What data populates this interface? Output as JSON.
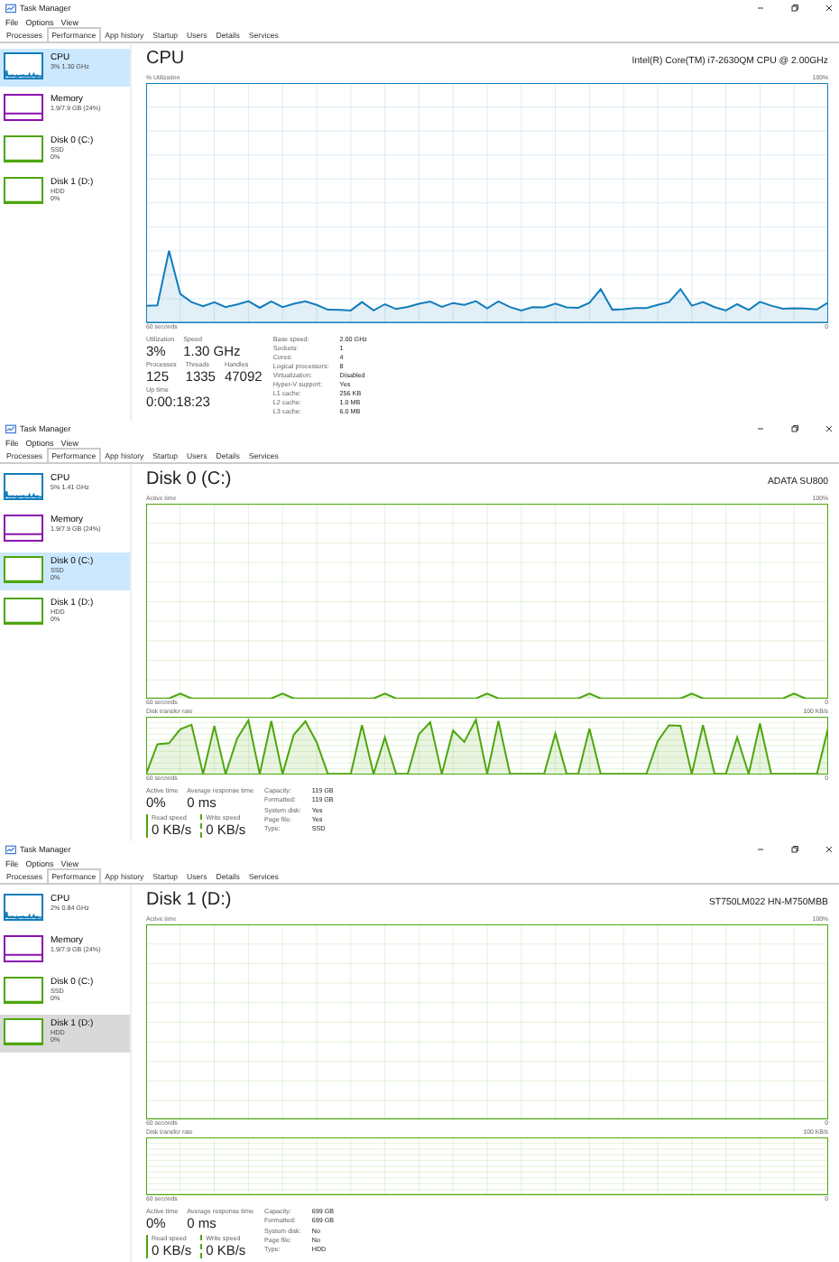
{
  "windows": [
    {
      "title": "Task Manager",
      "focused": true,
      "menu": [
        "File",
        "Options",
        "View"
      ],
      "tabs": [
        {
          "label": "Processes",
          "selected": false
        },
        {
          "label": "Performance",
          "selected": true
        },
        {
          "label": "App history",
          "selected": false
        },
        {
          "label": "Startup",
          "selected": false
        },
        {
          "label": "Users",
          "selected": false
        },
        {
          "label": "Details",
          "selected": false
        },
        {
          "label": "Services",
          "selected": false
        }
      ],
      "sidebar": [
        {
          "name": "CPU",
          "details": [
            "3% 1.30 GHz"
          ],
          "color": "#117dbb",
          "selected": true
        },
        {
          "name": "Memory",
          "details": [
            "1.9/7.9 GB (24%)"
          ],
          "color": "#8b12ae",
          "selected": false
        },
        {
          "name": "Disk 0 (C:)",
          "details": [
            "SSD",
            "0%"
          ],
          "color": "#4da60c",
          "selected": false
        },
        {
          "name": "Disk 1 (D:)",
          "details": [
            "HDD",
            "0%"
          ],
          "color": "#4da60c",
          "selected": false
        }
      ],
      "panel": {
        "title": "CPU",
        "model": "Intel(R) Core(TM) i7-2630QM CPU @ 2.00GHz",
        "graphs": [
          {
            "label": "% Utilization",
            "max": "100%",
            "span": "60 seconds",
            "min": "0"
          }
        ],
        "stat_rows": [
          [
            {
              "label": "Utilization",
              "value": "3%"
            },
            {
              "label": "Speed",
              "value": "1.30 GHz"
            }
          ],
          [
            {
              "label": "Processes",
              "value": "125"
            },
            {
              "label": "Threads",
              "value": "1335"
            },
            {
              "label": "Handles",
              "value": "47092"
            }
          ],
          [
            {
              "label": "Up time",
              "value": "0:00:18:23"
            }
          ]
        ],
        "specs": [
          {
            "label": "Base speed:",
            "value": "2.00 GHz"
          },
          {
            "label": "Sockets:",
            "value": "1"
          },
          {
            "label": "Cores:",
            "value": "4"
          },
          {
            "label": "Logical processors:",
            "value": "8"
          },
          {
            "label": "Virtualization:",
            "value": "Disabled"
          },
          {
            "label": "Hyper-V support:",
            "value": "Yes"
          },
          {
            "label": "L1 cache:",
            "value": "256 KB"
          },
          {
            "label": "L2 cache:",
            "value": "1.0 MB"
          },
          {
            "label": "L3 cache:",
            "value": "6.0 MB"
          }
        ]
      }
    },
    {
      "title": "Task Manager",
      "focused": true,
      "menu": [
        "File",
        "Options",
        "View"
      ],
      "tabs": [
        {
          "label": "Processes",
          "selected": false
        },
        {
          "label": "Performance",
          "selected": true
        },
        {
          "label": "App history",
          "selected": false
        },
        {
          "label": "Startup",
          "selected": false
        },
        {
          "label": "Users",
          "selected": false
        },
        {
          "label": "Details",
          "selected": false
        },
        {
          "label": "Services",
          "selected": false
        }
      ],
      "sidebar": [
        {
          "name": "CPU",
          "details": [
            "5% 1.41 GHz"
          ],
          "color": "#117dbb",
          "selected": false
        },
        {
          "name": "Memory",
          "details": [
            "1.9/7.9 GB (24%)"
          ],
          "color": "#8b12ae",
          "selected": false
        },
        {
          "name": "Disk 0 (C:)",
          "details": [
            "SSD",
            "0%"
          ],
          "color": "#4da60c",
          "selected": true
        },
        {
          "name": "Disk 1 (D:)",
          "details": [
            "HDD",
            "0%"
          ],
          "color": "#4da60c",
          "selected": false
        }
      ],
      "panel": {
        "title": "Disk 0 (C:)",
        "model": "ADATA SU800",
        "graphs": [
          {
            "label": "Active time",
            "max": "100%",
            "span": "60 seconds",
            "min": "0"
          },
          {
            "label": "Disk transfer rate",
            "max": "100 KB/s",
            "span": "60 seconds",
            "min": "0"
          }
        ],
        "stat_rows": [
          [
            {
              "label": "Active time",
              "value": "0%"
            },
            {
              "label": "Average response time",
              "value": "0 ms"
            }
          ],
          [
            {
              "label": "Read speed",
              "value": "0 KB/s",
              "kind": "read"
            },
            {
              "label": "Write speed",
              "value": "0 KB/s",
              "kind": "write"
            }
          ]
        ],
        "specs": [
          {
            "label": "Capacity:",
            "value": "119 GB"
          },
          {
            "label": "Formatted:",
            "value": "119 GB"
          },
          {
            "label": "System disk:",
            "value": "Yes"
          },
          {
            "label": "Page file:",
            "value": "Yes"
          },
          {
            "label": "Type:",
            "value": "SSD"
          }
        ]
      }
    },
    {
      "title": "Task Manager",
      "focused": false,
      "menu": [
        "File",
        "Options",
        "View"
      ],
      "tabs": [
        {
          "label": "Processes",
          "selected": false
        },
        {
          "label": "Performance",
          "selected": true
        },
        {
          "label": "App history",
          "selected": false
        },
        {
          "label": "Startup",
          "selected": false
        },
        {
          "label": "Users",
          "selected": false
        },
        {
          "label": "Details",
          "selected": false
        },
        {
          "label": "Services",
          "selected": false
        }
      ],
      "sidebar": [
        {
          "name": "CPU",
          "details": [
            "2% 0.84 GHz"
          ],
          "color": "#117dbb",
          "selected": false
        },
        {
          "name": "Memory",
          "details": [
            "1.9/7.9 GB (24%)"
          ],
          "color": "#8b12ae",
          "selected": false
        },
        {
          "name": "Disk 0 (C:)",
          "details": [
            "SSD",
            "0%"
          ],
          "color": "#4da60c",
          "selected": false
        },
        {
          "name": "Disk 1 (D:)",
          "details": [
            "HDD",
            "0%"
          ],
          "color": "#4da60c",
          "selected": true
        }
      ],
      "panel": {
        "title": "Disk 1 (D:)",
        "model": "ST750LM022 HN-M750MBB",
        "graphs": [
          {
            "label": "Active time",
            "max": "100%",
            "span": "60 seconds",
            "min": "0"
          },
          {
            "label": "Disk transfer rate",
            "max": "100 KB/s",
            "span": "60 seconds",
            "min": "0"
          }
        ],
        "stat_rows": [
          [
            {
              "label": "Active time",
              "value": "0%"
            },
            {
              "label": "Average response time",
              "value": "0 ms"
            }
          ],
          [
            {
              "label": "Read speed",
              "value": "0 KB/s",
              "kind": "read"
            },
            {
              "label": "Write speed",
              "value": "0 KB/s",
              "kind": "write"
            }
          ]
        ],
        "specs": [
          {
            "label": "Capacity:",
            "value": "699 GB"
          },
          {
            "label": "Formatted:",
            "value": "699 GB"
          },
          {
            "label": "System disk:",
            "value": "No"
          },
          {
            "label": "Page file:",
            "value": "No"
          },
          {
            "label": "Type:",
            "value": "HDD"
          }
        ]
      }
    }
  ]
}
